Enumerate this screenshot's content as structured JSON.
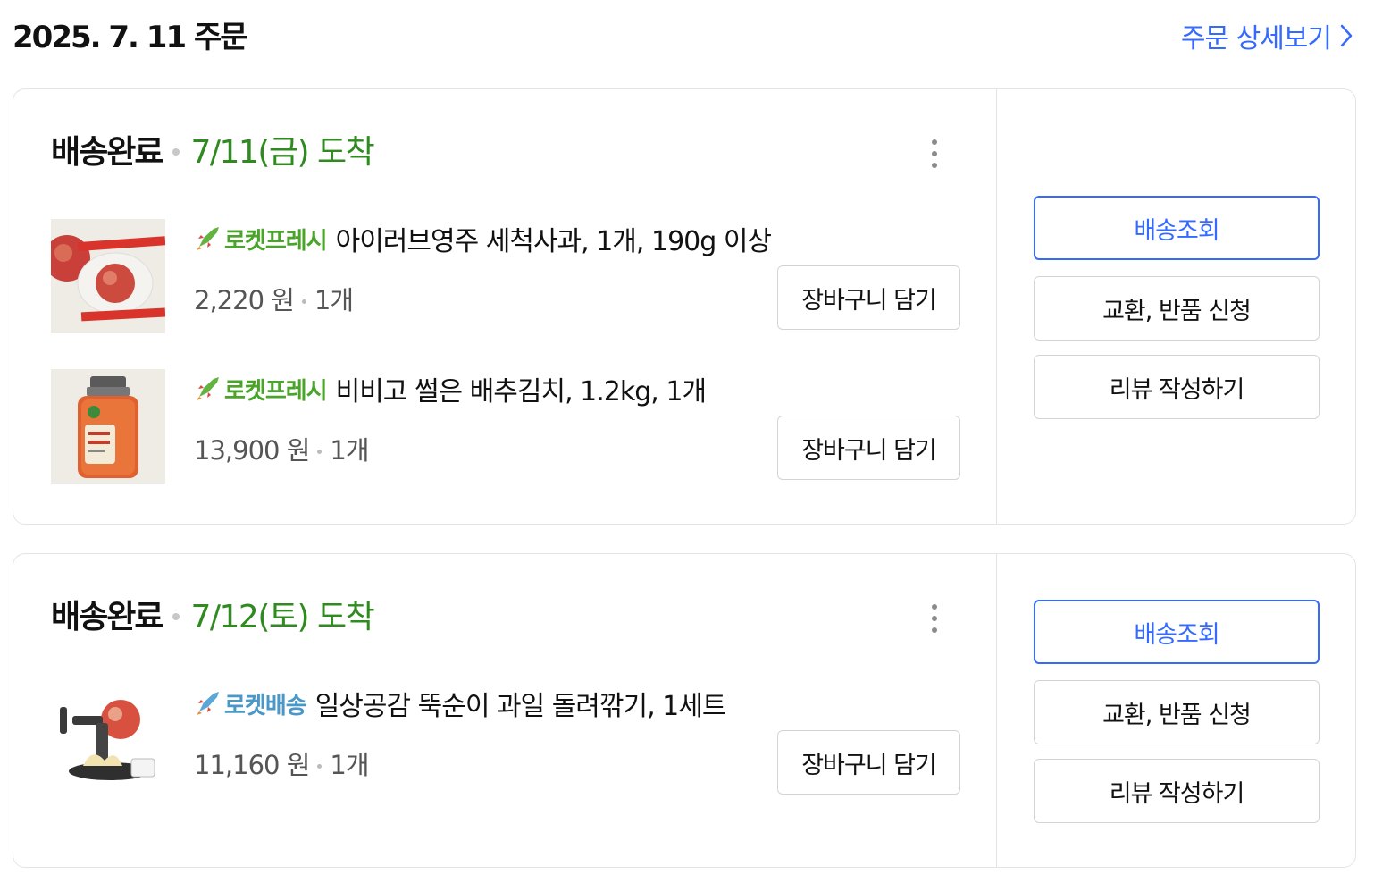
{
  "order": {
    "date_title": "2025. 7. 11 주문",
    "detail_link": "주문 상세보기"
  },
  "shipments": [
    {
      "status": "배송완료",
      "arrival": "7/11(금) 도착",
      "items": [
        {
          "badge": "로켓프레시",
          "badge_color": "#4aa42a",
          "thumbnail_icon": "apple-product-icon",
          "name": "아이러브영주 세척사과, 1개, 190g 이상",
          "price": "2,220 원",
          "quantity": "1개",
          "cart_button": "장바구니 담기"
        },
        {
          "badge": "로켓프레시",
          "badge_color": "#4aa42a",
          "thumbnail_icon": "kimchi-jar-product-icon",
          "name": "비비고 썰은 배추김치, 1.2kg, 1개",
          "price": "13,900 원",
          "quantity": "1개",
          "cart_button": "장바구니 담기"
        }
      ],
      "actions": {
        "track": "배송조회",
        "exchange_return": "교환, 반품 신청",
        "review": "리뷰 작성하기"
      }
    },
    {
      "status": "배송완료",
      "arrival": "7/12(토) 도착",
      "items": [
        {
          "badge": "로켓배송",
          "badge_color": "#4a97c8",
          "thumbnail_icon": "fruit-peeler-product-icon",
          "name": "일상공감 뚝순이 과일 돌려깎기, 1세트",
          "price": "11,160 원",
          "quantity": "1개",
          "cart_button": "장바구니 담기"
        }
      ],
      "actions": {
        "track": "배송조회",
        "exchange_return": "교환, 반품 신청",
        "review": "리뷰 작성하기"
      }
    }
  ],
  "colors": {
    "accent_blue": "#346aff",
    "arrival_green": "#2f8a1f",
    "border": "#e4e4e4"
  }
}
